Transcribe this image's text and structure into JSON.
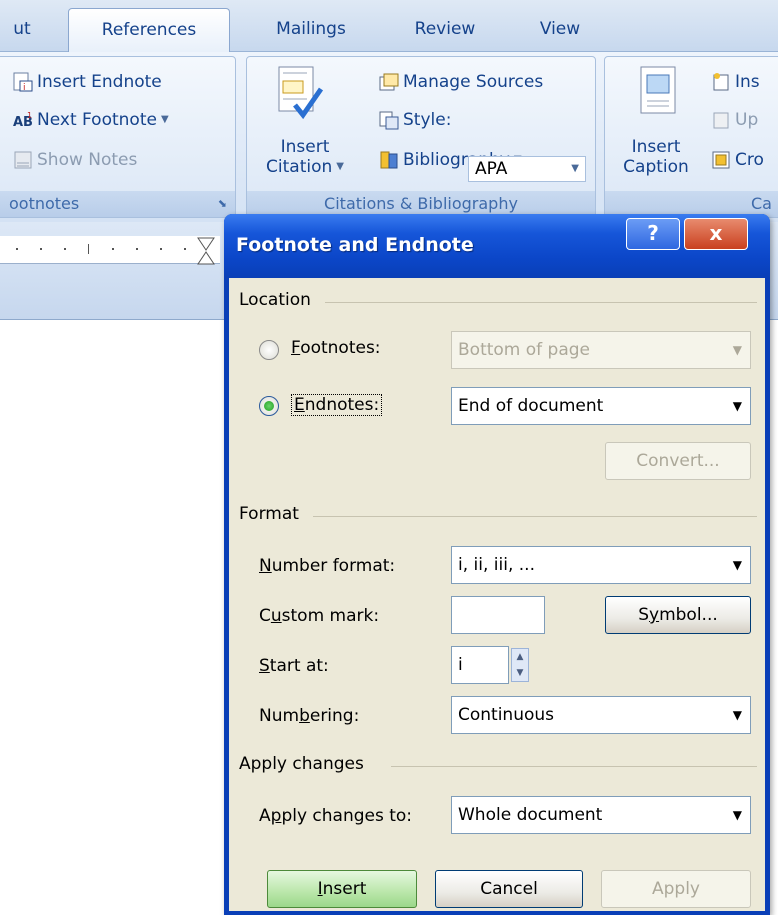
{
  "ribbon": {
    "tabs": [
      "ut",
      "References",
      "Mailings",
      "Review",
      "View"
    ],
    "active_tab": "References",
    "footnotes_group": {
      "label": "ootnotes",
      "insert_endnote": "Insert Endnote",
      "next_footnote": "Next Footnote",
      "show_notes": "Show Notes"
    },
    "citations_group": {
      "label": "Citations & Bibliography",
      "insert_citation_line1": "Insert",
      "insert_citation_line2": "Citation",
      "manage_sources": "Manage Sources",
      "style_label": "Style:",
      "style_value": "APA",
      "bibliography": "Bibliography"
    },
    "captions_group": {
      "label": "Ca",
      "insert_caption_line1": "Insert",
      "insert_caption_line2": "Caption",
      "ins": "Ins",
      "up": "Up",
      "cro": "Cro"
    }
  },
  "dialog": {
    "title": "Footnote and Endnote",
    "help": "?",
    "close": "x",
    "location": {
      "title": "Location",
      "footnotes_label": "Footnotes:",
      "footnotes_value": "Bottom of page",
      "endnotes_label": "Endnotes:",
      "endnotes_value": "End of document",
      "selected": "endnotes",
      "convert": "Convert..."
    },
    "format": {
      "title": "Format",
      "number_format_label": "Number format:",
      "number_format_value": "i, ii, iii, ...",
      "custom_mark_label": "Custom mark:",
      "custom_mark_value": "",
      "symbol": "Symbol...",
      "start_at_label": "Start at:",
      "start_at_value": "i",
      "numbering_label": "Numbering:",
      "numbering_value": "Continuous"
    },
    "apply_changes": {
      "title": "Apply changes",
      "apply_to_label": "Apply changes to:",
      "apply_to_value": "Whole document"
    },
    "buttons": {
      "insert": "Insert",
      "cancel": "Cancel",
      "apply": "Apply"
    }
  }
}
